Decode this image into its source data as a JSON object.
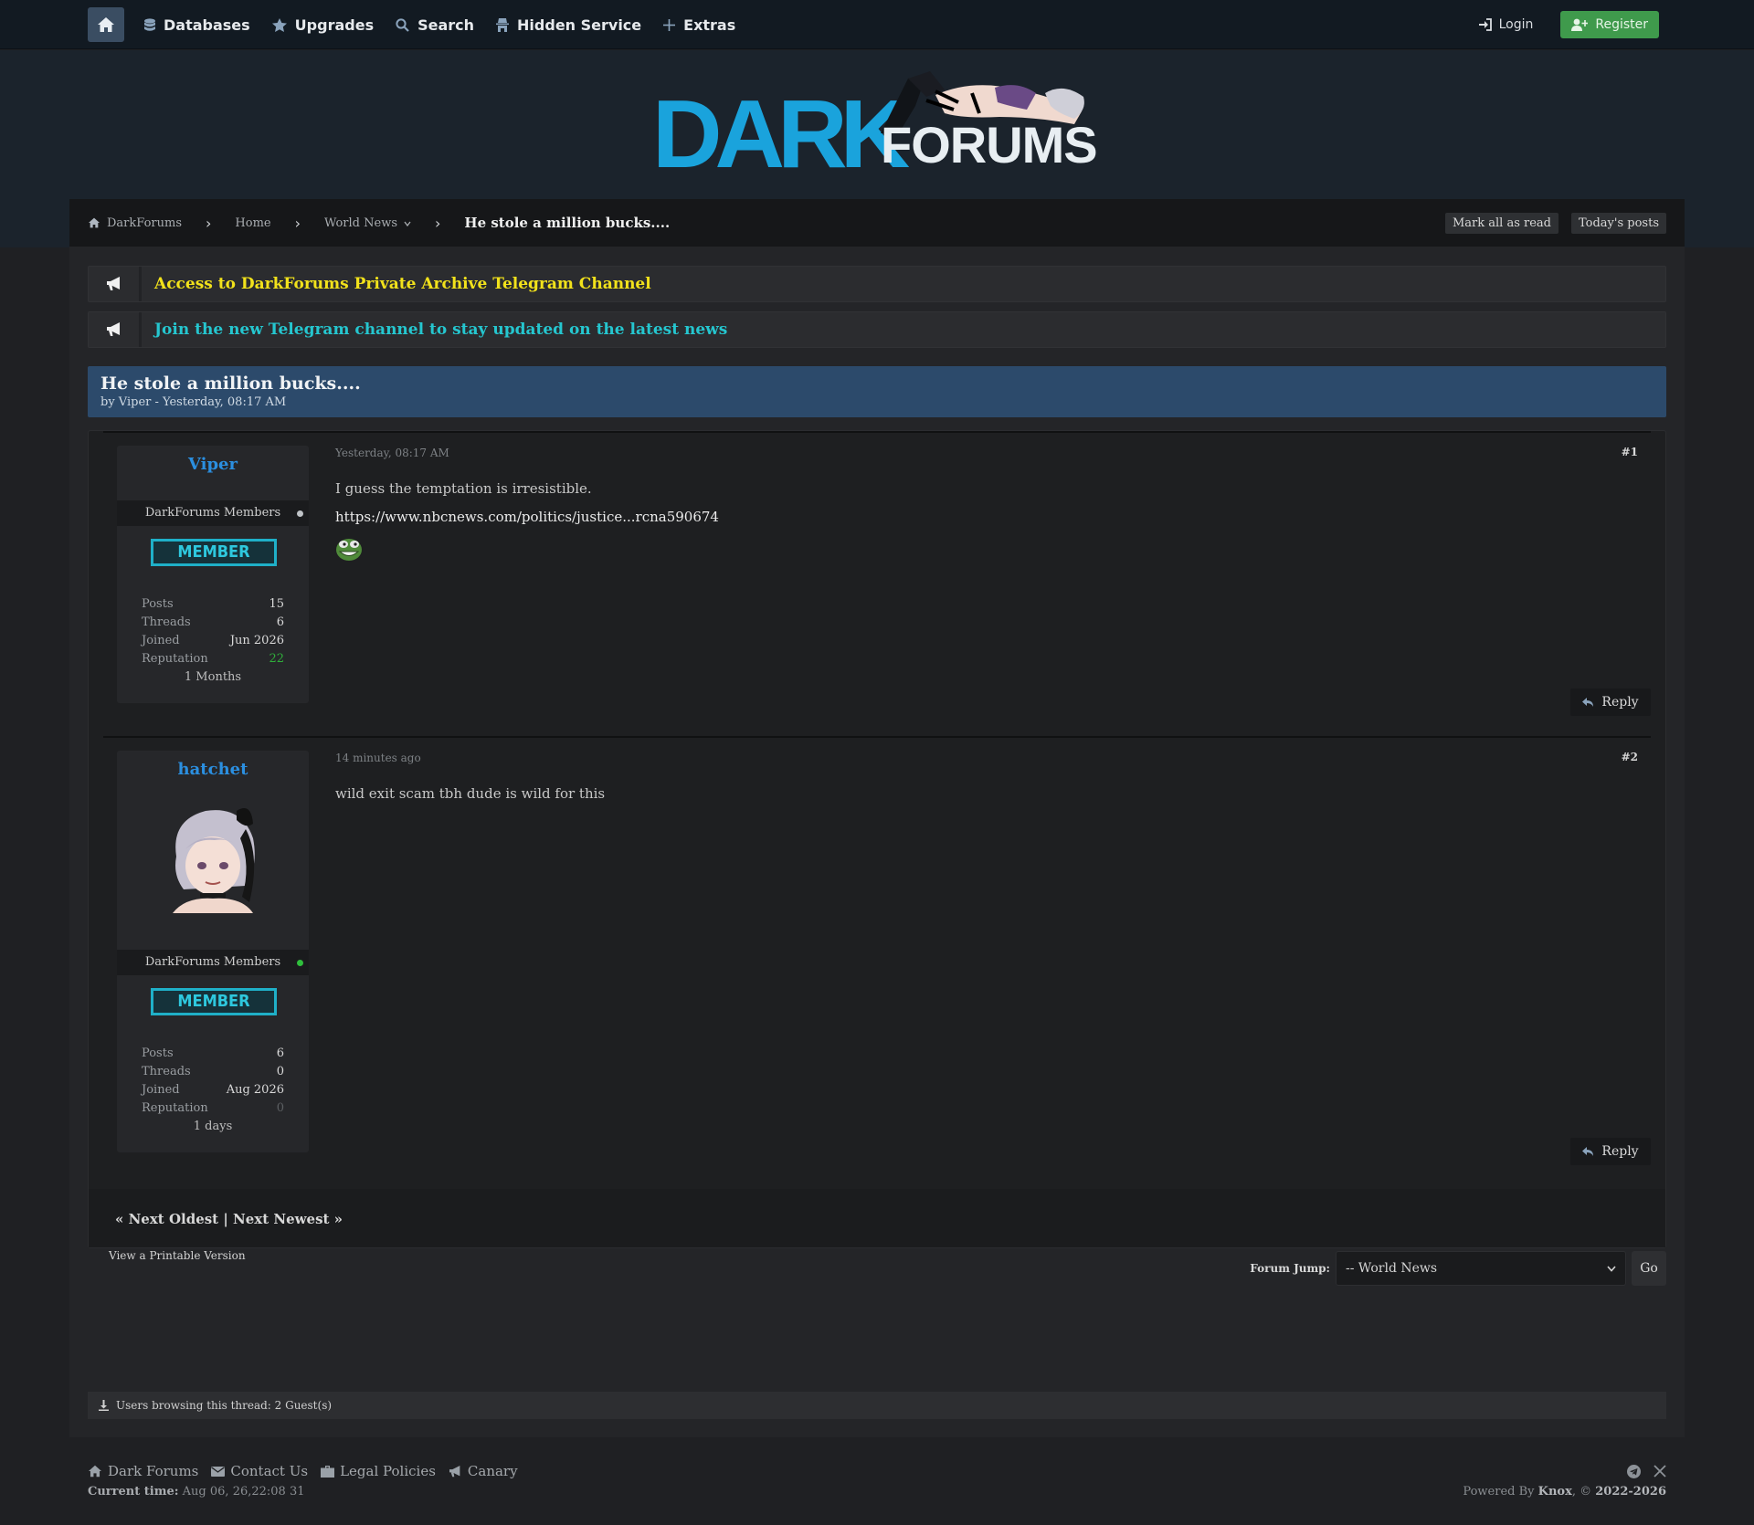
{
  "nav": {
    "items": [
      {
        "label": "Databases",
        "icon": "database-icon"
      },
      {
        "label": "Upgrades",
        "icon": "star-icon"
      },
      {
        "label": "Search",
        "icon": "search-icon"
      },
      {
        "label": "Hidden Service",
        "icon": "incognito-icon"
      },
      {
        "label": "Extras",
        "icon": "plus-icon"
      }
    ],
    "login_label": "Login",
    "register_label": "Register"
  },
  "logo": {
    "dark": "DARK",
    "forums": "FORUMS"
  },
  "breadcrumb": {
    "items": [
      "DarkForums",
      "Home",
      "World News"
    ],
    "current": "He stole a million bucks....",
    "mark_read_label": "Mark all as read",
    "today_label": "Today's posts"
  },
  "announcements": [
    {
      "text": "Access to DarkForums Private Archive Telegram Channel",
      "color": "#f2e21b"
    },
    {
      "text": "Join the new Telegram channel to stay updated on the latest news",
      "color": "#25c6cf"
    }
  ],
  "thread": {
    "title": "He stole a million bucks....",
    "meta": "by Viper - Yesterday, 08:17 AM"
  },
  "posts": [
    {
      "username": "Viper",
      "group": "DarkForums Members",
      "online": false,
      "rank": "MEMBER",
      "stats": {
        "posts_label": "Posts",
        "posts": "15",
        "threads_label": "Threads",
        "threads": "6",
        "joined_label": "Joined",
        "joined": "Jun 2026",
        "rep_label": "Reputation",
        "rep": "22"
      },
      "since": "1 Months",
      "date": "Yesterday, 08:17 AM",
      "number": "#1",
      "text": "I guess the temptation is irresistible.",
      "link": "https://www.nbcnews.com/politics/justice...rcna590674",
      "reply_label": "Reply"
    },
    {
      "username": "hatchet",
      "group": "DarkForums Members",
      "online": true,
      "rank": "MEMBER",
      "stats": {
        "posts_label": "Posts",
        "posts": "6",
        "threads_label": "Threads",
        "threads": "0",
        "joined_label": "Joined",
        "joined": "Aug 2026",
        "rep_label": "Reputation",
        "rep": "0"
      },
      "since": "1 days",
      "date": "14 minutes ago",
      "number": "#2",
      "text": "wild exit scam tbh dude is wild for this",
      "reply_label": "Reply"
    }
  ],
  "thread_nav": "« Next Oldest | Next Newest »",
  "printable_label": "View a Printable Version",
  "forum_jump": {
    "label": "Forum Jump:",
    "selected": "-- World News",
    "go_label": "Go"
  },
  "browsing": "Users browsing this thread: 2 Guest(s)",
  "footer": {
    "links": [
      {
        "label": "Dark Forums",
        "icon": "home-icon"
      },
      {
        "label": "Contact Us",
        "icon": "envelope-icon"
      },
      {
        "label": "Legal Policies",
        "icon": "briefcase-icon"
      },
      {
        "label": "Canary",
        "icon": "bullhorn-icon"
      }
    ],
    "current_time_label": "Current time:",
    "current_time": "Aug 06, 26,22:08 31",
    "powered_prefix": "Powered By",
    "powered_name": "Knox",
    "powered_suffix": ", ©",
    "powered_years": "2022-2026"
  },
  "colors": {
    "accent": "#1aa3dc",
    "register": "#3f9a4c",
    "thread_header": "#2c4a6b",
    "username": "#2b8fe0"
  }
}
